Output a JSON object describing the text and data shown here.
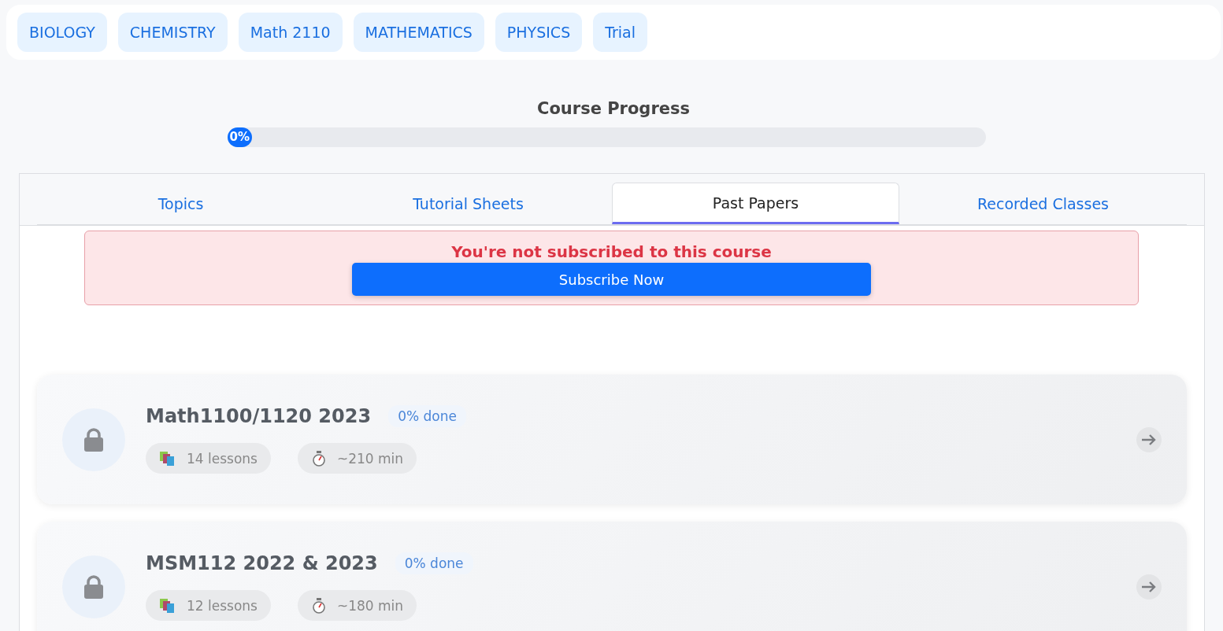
{
  "subjects": [
    {
      "label": "BIOLOGY",
      "selected": false
    },
    {
      "label": "CHEMISTRY",
      "selected": false
    },
    {
      "label": "Math 2110",
      "selected": false
    },
    {
      "label": "MATHEMATICS",
      "selected": false
    },
    {
      "label": "PHYSICS",
      "selected": false
    },
    {
      "label": "Trial",
      "selected": false
    }
  ],
  "progress": {
    "title": "Course Progress",
    "level": 0,
    "reading": "0%"
  },
  "tabs": [
    {
      "label": "Topics",
      "selected": false
    },
    {
      "label": "Tutorial Sheets",
      "selected": false
    },
    {
      "label": "Past Papers",
      "selected": true
    },
    {
      "label": "Recorded Classes",
      "selected": false
    }
  ],
  "alert": {
    "message": "You're not subscribed to this course",
    "button": "Subscribe Now"
  },
  "papers": [
    {
      "title": "Math1100/1120 2023",
      "done": "0% done",
      "locked": true,
      "lessons": "14 lessons",
      "duration": "~210 min"
    },
    {
      "title": "MSM112 2022 & 2023",
      "done": "0% done",
      "locked": true,
      "lessons": "12 lessons",
      "duration": "~180 min"
    }
  ]
}
